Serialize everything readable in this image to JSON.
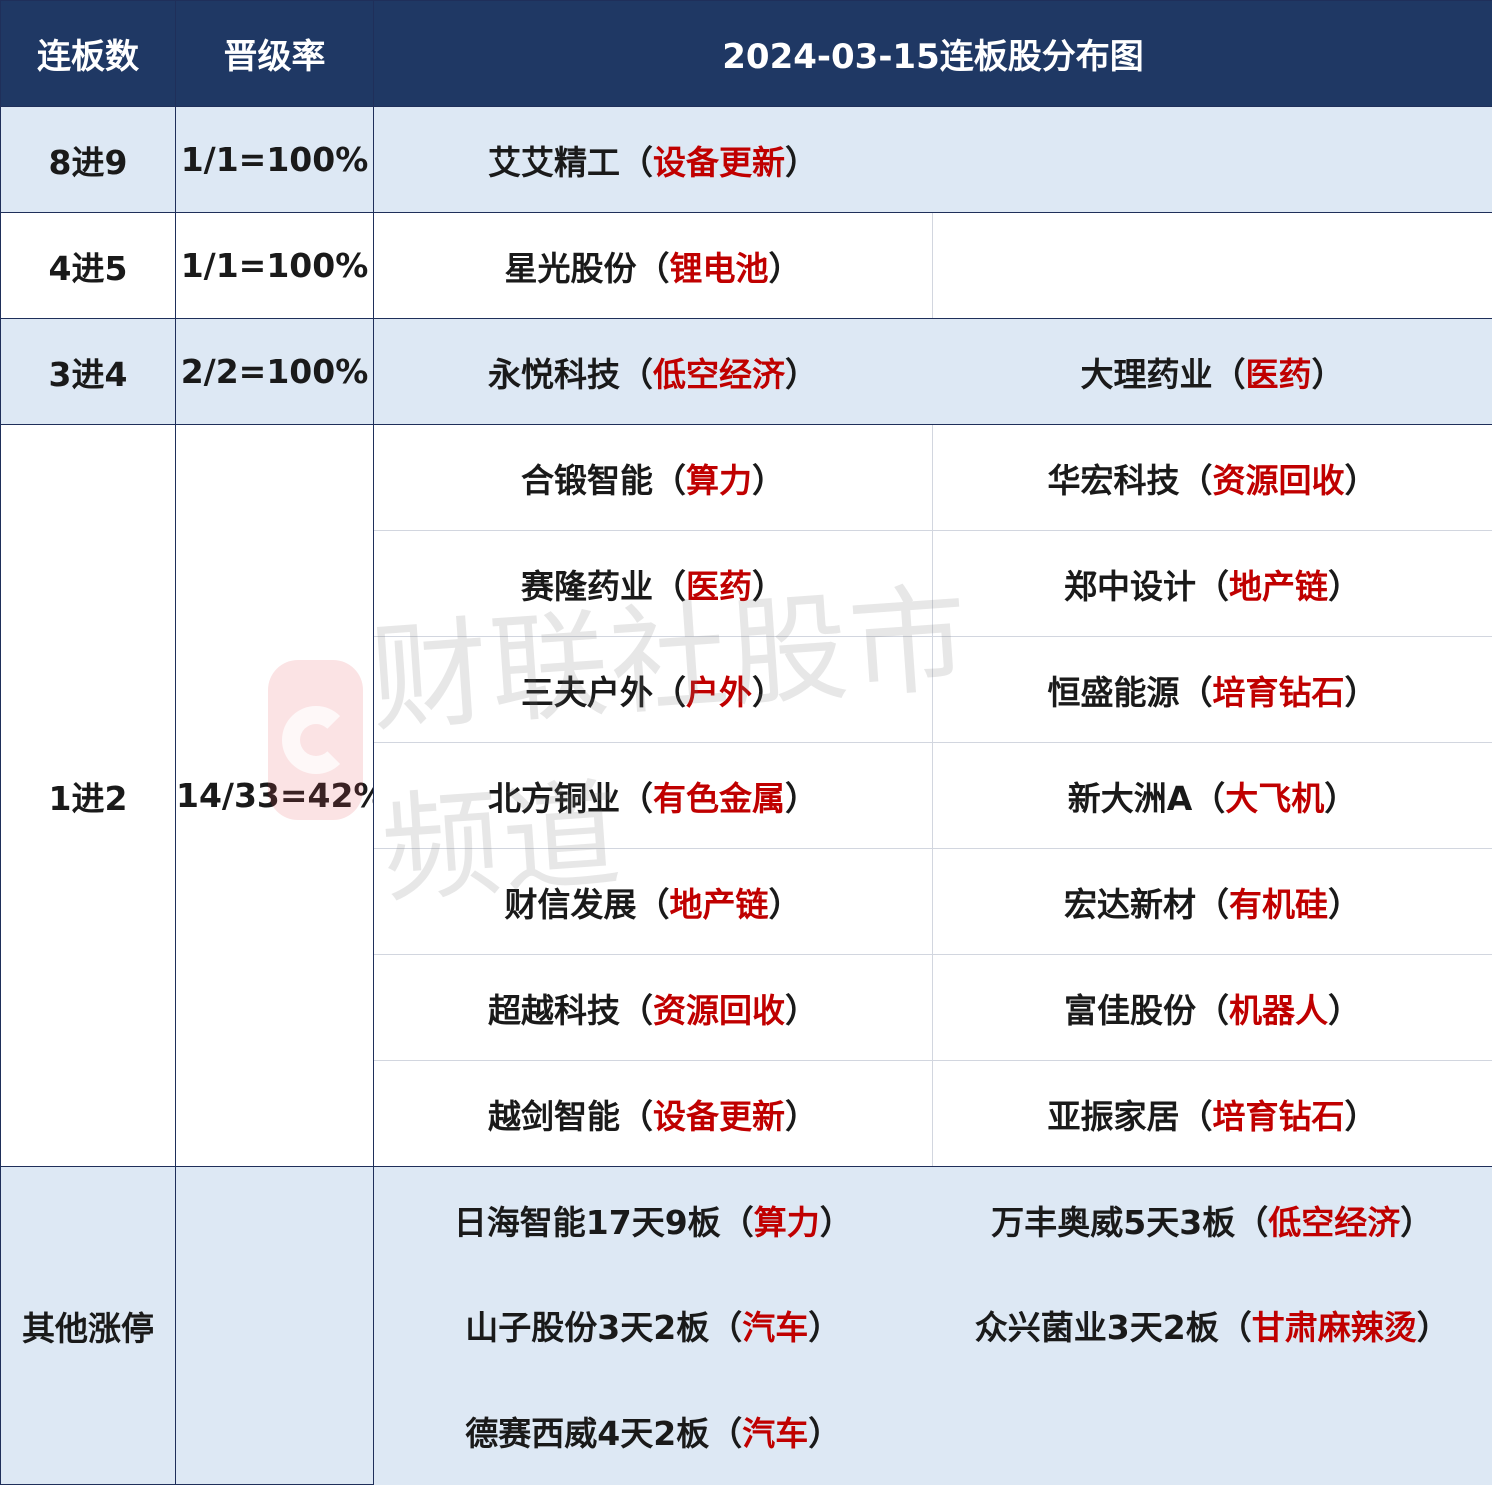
{
  "header": {
    "col1": "连板数",
    "col2": "晋级率",
    "col3": "2024-03-15连板股分布图"
  },
  "rows": {
    "r8to9": {
      "label": "8进9",
      "rate": "1/1=100%",
      "stock1": {
        "name": "艾艾精工",
        "tag": "设备更新"
      }
    },
    "r4to5": {
      "label": "4进5",
      "rate": "1/1=100%",
      "stock1": {
        "name": "星光股份",
        "tag": "锂电池"
      }
    },
    "r3to4": {
      "label": "3进4",
      "rate": "2/2=100%",
      "stock1": {
        "name": "永悦科技",
        "tag": "低空经济"
      },
      "stock2": {
        "name": "大理药业",
        "tag": "医药"
      }
    },
    "r1to2": {
      "label": "1进2",
      "rate": "14/33=42%",
      "items": [
        {
          "left": {
            "name": "合锻智能",
            "tag": "算力"
          },
          "right": {
            "name": "华宏科技",
            "tag": "资源回收"
          }
        },
        {
          "left": {
            "name": "赛隆药业",
            "tag": "医药"
          },
          "right": {
            "name": "郑中设计",
            "tag": "地产链"
          }
        },
        {
          "left": {
            "name": "三夫户外",
            "tag": "户外"
          },
          "right": {
            "name": "恒盛能源",
            "tag": "培育钻石"
          }
        },
        {
          "left": {
            "name": "北方铜业",
            "tag": "有色金属"
          },
          "right": {
            "name": "新大洲A",
            "tag": "大飞机"
          }
        },
        {
          "left": {
            "name": "财信发展",
            "tag": "地产链"
          },
          "right": {
            "name": "宏达新材",
            "tag": "有机硅"
          }
        },
        {
          "left": {
            "name": "超越科技",
            "tag": "资源回收"
          },
          "right": {
            "name": "富佳股份",
            "tag": "机器人"
          }
        },
        {
          "left": {
            "name": "越剑智能",
            "tag": "设备更新"
          },
          "right": {
            "name": "亚振家居",
            "tag": "培育钻石"
          }
        }
      ]
    },
    "other": {
      "label": "其他涨停",
      "rate": "",
      "items": [
        {
          "left": {
            "name": "日海智能17天9板",
            "tag": "算力"
          },
          "right": {
            "name": "万丰奥威5天3板",
            "tag": "低空经济"
          }
        },
        {
          "left": {
            "name": "山子股份3天2板",
            "tag": "汽车"
          },
          "right": {
            "name": "众兴菌业3天2板",
            "tag": "甘肃麻辣烫"
          }
        },
        {
          "left": {
            "name": "德赛西威4天2板",
            "tag": "汽车"
          },
          "right": null
        }
      ]
    }
  },
  "punct": {
    "open": "（",
    "close": "）"
  },
  "watermark": {
    "text": "财联社股市频道"
  },
  "colors": {
    "header_bg": "#1f3864",
    "row_blue": "#dde8f4",
    "tag_red": "#c00000"
  }
}
